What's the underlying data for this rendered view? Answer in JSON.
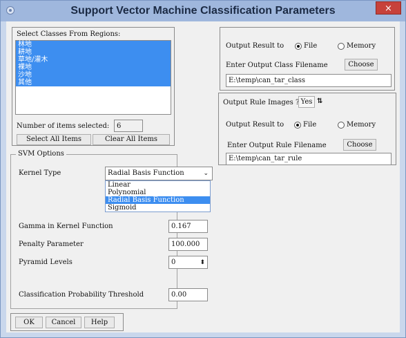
{
  "window": {
    "title": "Support Vector Machine Classification Parameters",
    "close_glyph": "×"
  },
  "classes": {
    "label": "Select Classes From Regions:",
    "items": [
      "林地",
      "耕地",
      "草地/灌木",
      "裸地",
      "沙地",
      "其他"
    ],
    "count_label": "Number of items selected:",
    "count_value": "6",
    "select_all": "Select All Items",
    "clear_all": "Clear All Items"
  },
  "svm": {
    "group_title": "SVM Options",
    "kernel_label": "Kernel Type",
    "kernel_value": "Radial Basis Function",
    "kernel_options": [
      "Linear",
      "Polynomial",
      "Radial Basis Function",
      "Sigmoid"
    ],
    "gamma_label": "Gamma in Kernel Function",
    "gamma_value": "0.167",
    "penalty_label": "Penalty Parameter",
    "penalty_value": "100.000",
    "pyramid_label": "Pyramid Levels",
    "pyramid_value": "0",
    "threshold_label": "Classification Probability Threshold",
    "threshold_value": "0.00"
  },
  "output_class": {
    "result_label": "Output Result to",
    "file_label": "File",
    "memory_label": "Memory",
    "filename_label": "Enter Output Class Filename",
    "choose": "Choose",
    "path": "E:\\temp\\can_tar_class"
  },
  "output_rule": {
    "images_label": "Output Rule Images ?",
    "images_value": "Yes",
    "toggle_glyph": "⇅",
    "result_label": "Output Result to",
    "file_label": "File",
    "memory_label": "Memory",
    "filename_label": "Enter Output Rule Filename",
    "choose": "Choose",
    "path": "E:\\temp\\can_tar_rule"
  },
  "footer": {
    "ok": "OK",
    "cancel": "Cancel",
    "help": "Help"
  },
  "colors": {
    "selection": "#3d8ef0",
    "titlebar": "#9fb7dd",
    "close": "#c7413a"
  }
}
